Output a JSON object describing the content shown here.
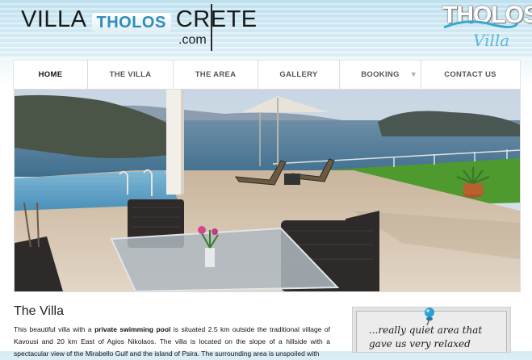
{
  "header": {
    "logo_left": "VILLA",
    "logo_middle": "THOLOS",
    "logo_right": "CRETE",
    "logo_domain": ".com",
    "brand_name": "THOLOS",
    "brand_sub": "Villa"
  },
  "nav": {
    "items": [
      {
        "label": "HOME"
      },
      {
        "label": "THE VILLA"
      },
      {
        "label": "THE AREA"
      },
      {
        "label": "GALLERY"
      },
      {
        "label": "BOOKING"
      },
      {
        "label": "CONTACT US"
      }
    ],
    "active": "HOME",
    "dropdown_arrow": "▼"
  },
  "main": {
    "title": "The Villa",
    "paragraph_part1": "This beautiful villa with a ",
    "paragraph_bold": "private swimming pool",
    "paragraph_part2": " is situated 2.5 km outside the traditional village of Kavousi and 20 km East of Agios Nikolaos. The villa is located on the slope of a hillside with a spectacular view of the Mirabello Gulf and the island of Psira. The surrounding area is unspoiled with"
  },
  "testimonial": {
    "line1": "...really quiet area that",
    "line2": "gave us very relaxed"
  },
  "colors": {
    "accent_blue": "#2c8ec0",
    "sky": "#bfe1ef",
    "sea": "#3f6f8e",
    "lawn": "#4f9a2e"
  },
  "icons": {
    "pin": "pushpin-icon",
    "dropdown": "chevron-down-icon"
  }
}
